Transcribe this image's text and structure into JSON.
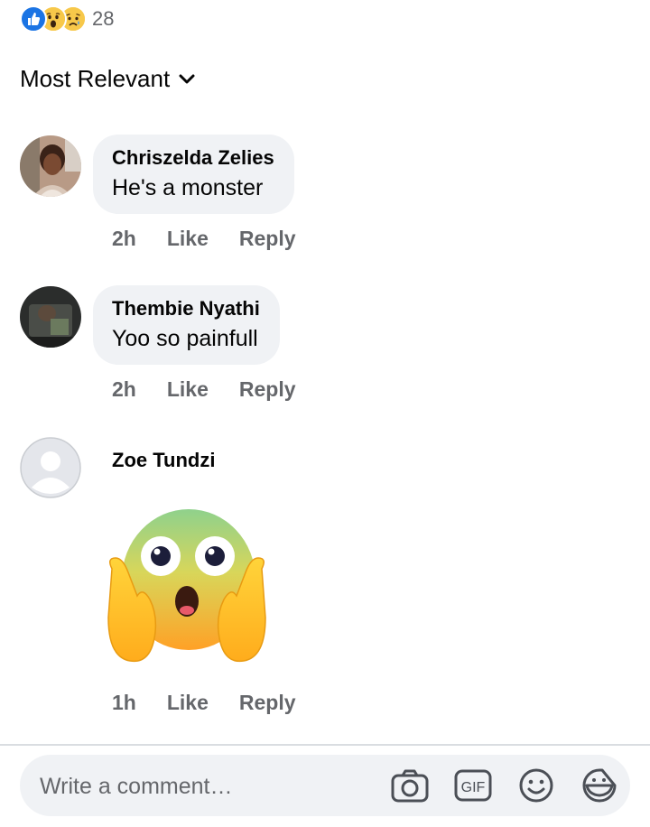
{
  "reactions": {
    "icons": [
      "like-icon",
      "wow-icon",
      "sad-icon"
    ],
    "count": "28"
  },
  "sort": {
    "label": "Most Relevant",
    "icon": "chevron-down-icon"
  },
  "comments": [
    {
      "author": "Chriszelda Zelies",
      "text": "He's a monster",
      "time": "2h",
      "like": "Like",
      "reply": "Reply"
    },
    {
      "author": "Thembie Nyathi",
      "text": "Yoo so painfull",
      "time": "2h",
      "like": "Like",
      "reply": "Reply"
    },
    {
      "author": "Zoe Tundzi",
      "sticker": "shocked-face-emoji",
      "time": "1h",
      "like": "Like",
      "reply": "Reply"
    }
  ],
  "composer": {
    "placeholder": "Write a comment…",
    "icons": [
      "camera-icon",
      "gif-icon",
      "emoji-icon",
      "sticker-icon"
    ],
    "gif_label": "GIF"
  },
  "colors": {
    "like_blue": "#1b74e4",
    "bubble_bg": "#f0f2f5",
    "meta_gray": "#65676b"
  }
}
